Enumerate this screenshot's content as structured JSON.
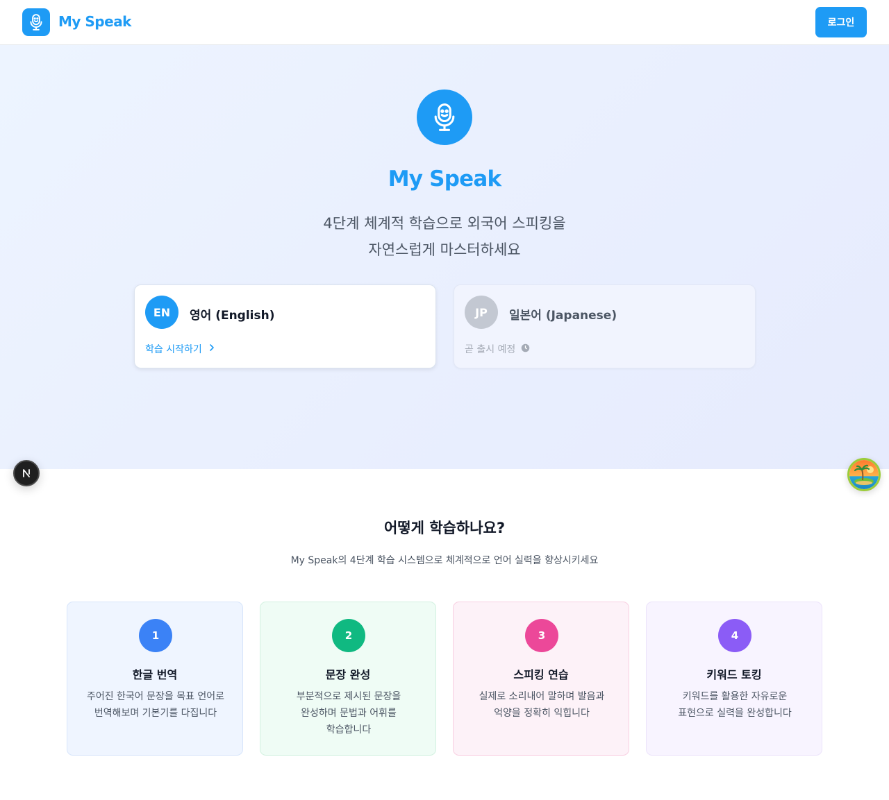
{
  "header": {
    "app_name": "My Speak",
    "login_label": "로그인"
  },
  "hero": {
    "title": "My Speak",
    "subtitle_line1": "4단계 체계적 학습으로 외국어 스피킹을",
    "subtitle_line2": "자연스럽게 마스터하세요"
  },
  "languages": [
    {
      "code": "EN",
      "name": "영어 (English)",
      "action": "학습 시작하기",
      "enabled": true
    },
    {
      "code": "JP",
      "name": "일본어 (Japanese)",
      "action": "곧 출시 예정",
      "enabled": false
    }
  ],
  "how_it_works": {
    "title": "어떻게 학습하나요?",
    "subtitle": "My Speak의 4단계 학습 시스템으로 체계적으로 언어 실력을 향상시키세요",
    "steps": [
      {
        "number": "1",
        "title": "한글 번역",
        "description": "주어진 한국어 문장을 목표 언어로 번역해보며 기본기를 다집니다"
      },
      {
        "number": "2",
        "title": "문장 완성",
        "description": "부분적으로 제시된 문장을 완성하며 문법과 어휘를 학습합니다"
      },
      {
        "number": "3",
        "title": "스피킹 연습",
        "description": "실제로 소리내어 말하며 발음과 억양을 정확히 익힙니다"
      },
      {
        "number": "4",
        "title": "키워드 토킹",
        "description": "키워드를 활용한 자유로운 표현으로 실력을 완성합니다"
      }
    ]
  },
  "colors": {
    "brand": "#1e9bf5",
    "step1": "#3b82f6",
    "step2": "#10b981",
    "step3": "#ec4899",
    "step4": "#8b5cf6"
  },
  "icons": {
    "logo": "microphone-smile-icon",
    "hero": "microphone-smile-icon",
    "start_arrow": "chevron-right-icon",
    "coming_soon": "clock-icon",
    "floating_left": "nextjs-icon",
    "floating_right": "island-icon"
  }
}
